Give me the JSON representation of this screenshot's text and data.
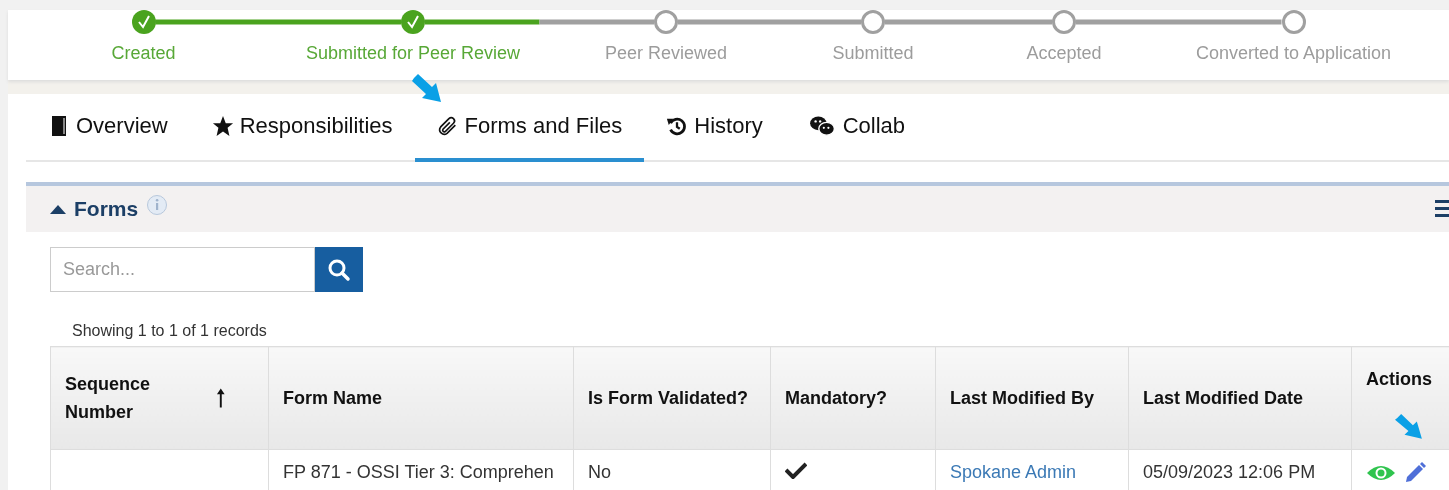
{
  "progress_steps": [
    {
      "label": "Created",
      "completed": true
    },
    {
      "label": "Submitted for Peer Review",
      "completed": true
    },
    {
      "label": "Peer Reviewed",
      "completed": false
    },
    {
      "label": "Submitted",
      "completed": false
    },
    {
      "label": "Accepted",
      "completed": false
    },
    {
      "label": "Converted to Application",
      "completed": false
    }
  ],
  "tabs": [
    {
      "label": "Overview",
      "selected": false
    },
    {
      "label": "Responsibilities",
      "selected": false
    },
    {
      "label": "Forms and Files",
      "selected": true
    },
    {
      "label": "History",
      "selected": false
    },
    {
      "label": "Collab",
      "selected": false
    }
  ],
  "section": {
    "title": "Forms",
    "expanded": true
  },
  "search": {
    "placeholder": "Search..."
  },
  "record_count": "Showing 1 to 1 of 1 records",
  "table": {
    "columns": [
      {
        "label": "Sequence Number",
        "sorted": true
      },
      {
        "label": "Form Name",
        "sorted": false
      },
      {
        "label": "Is Form Validated?",
        "sorted": false
      },
      {
        "label": "Mandatory?",
        "sorted": false
      },
      {
        "label": "Last Modified By",
        "sorted": false
      },
      {
        "label": "Last Modified Date",
        "sorted": false
      },
      {
        "label": "Actions",
        "sorted": false
      }
    ],
    "rows": [
      {
        "sequence_number": "",
        "form_name": "FP 871 - OSSI Tier 3: Comprehen",
        "is_form_validated": "No",
        "mandatory": true,
        "last_modified_by": "Spokane Admin",
        "last_modified_date": "05/09/2023 12:06 PM"
      }
    ]
  }
}
